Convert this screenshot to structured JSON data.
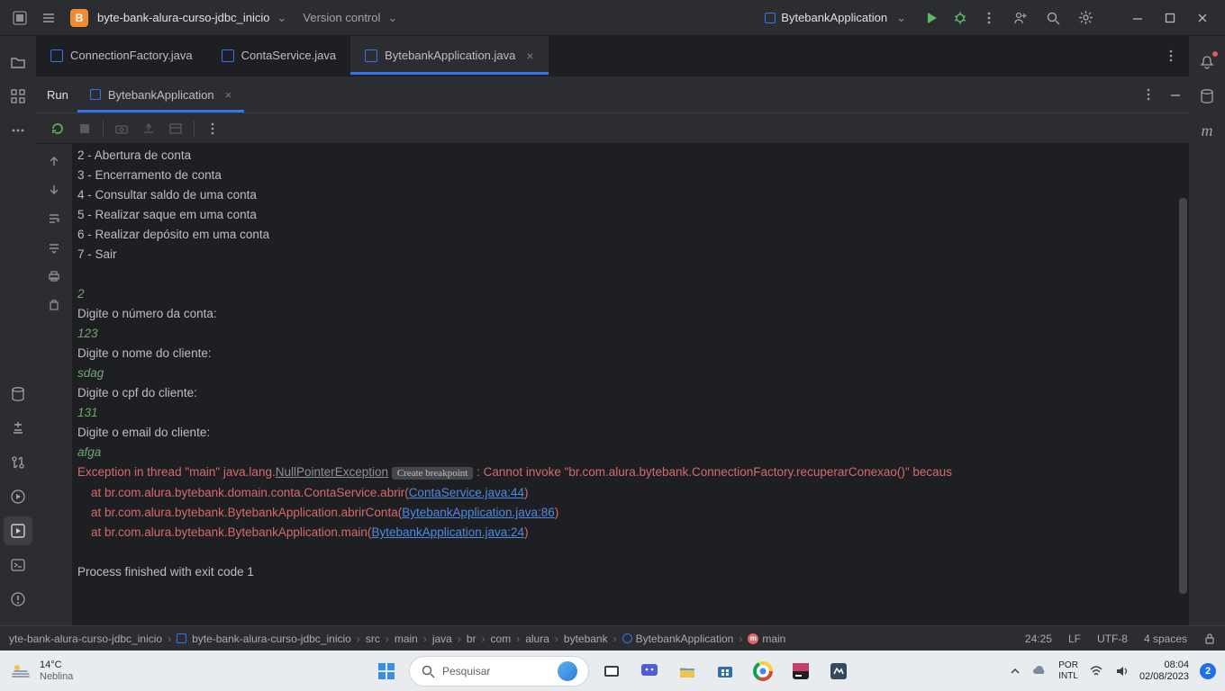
{
  "titlebar": {
    "project_initial": "B",
    "project_name": "byte-bank-alura-curso-jdbc_inicio",
    "version_control": "Version control",
    "run_config": "BytebankApplication"
  },
  "tabs": [
    {
      "label": "ConnectionFactory.java",
      "active": false,
      "closeable": false
    },
    {
      "label": "ContaService.java",
      "active": false,
      "closeable": false
    },
    {
      "label": "BytebankApplication.java",
      "active": true,
      "closeable": true
    }
  ],
  "tool_window": {
    "title": "Run",
    "tab": "BytebankApplication"
  },
  "console": {
    "menu_lines": [
      "2 - Abertura de conta",
      "3 - Encerramento de conta",
      "4 - Consultar saldo de uma conta",
      "5 - Realizar saque em uma conta",
      "6 - Realizar depósito em uma conta",
      "7 - Sair"
    ],
    "input_choice": "2",
    "prompt_account": "Digite o número da conta:",
    "input_account": "123",
    "prompt_name": "Digite o nome do cliente:",
    "input_name": "sdag",
    "prompt_cpf": "Digite o cpf do cliente:",
    "input_cpf": "131",
    "prompt_email": "Digite o email do cliente:",
    "input_email": "afga",
    "err_head_a": "Exception in thread \"main\" java.lang.",
    "err_npe": "NullPointerException",
    "err_bp": "Create breakpoint",
    "err_head_b": ": Cannot invoke \"br.com.alura.bytebank.ConnectionFactory.recuperarConexao()\" becaus",
    "err_at1_a": "    at br.com.alura.bytebank.domain.conta.ContaService.abrir(",
    "err_at1_l": "ContaService.java:44",
    "err_at2_a": "    at br.com.alura.bytebank.BytebankApplication.abrirConta(",
    "err_at2_l": "BytebankApplication.java:86",
    "err_at3_a": "    at br.com.alura.bytebank.BytebankApplication.main(",
    "err_at3_l": "BytebankApplication.java:24",
    "err_paren": ")",
    "exit": "Process finished with exit code 1"
  },
  "breadcrumbs": {
    "root_r": "yte-bank-alura-curso-jdbc_inicio",
    "mod": "byte-bank-alura-curso-jdbc_inicio",
    "parts": [
      "src",
      "main",
      "java",
      "br",
      "com",
      "alura",
      "bytebank"
    ],
    "cls": "BytebankApplication",
    "method": "main"
  },
  "statusbar": {
    "pos": "24:25",
    "eol": "LF",
    "enc": "UTF-8",
    "indent": "4 spaces"
  },
  "os": {
    "weather_temp": "14°C",
    "weather_desc": "Neblina",
    "search_placeholder": "Pesquisar",
    "lang1": "POR",
    "lang2": "INTL",
    "time": "08:04",
    "date": "02/08/2023",
    "badge": "2"
  }
}
